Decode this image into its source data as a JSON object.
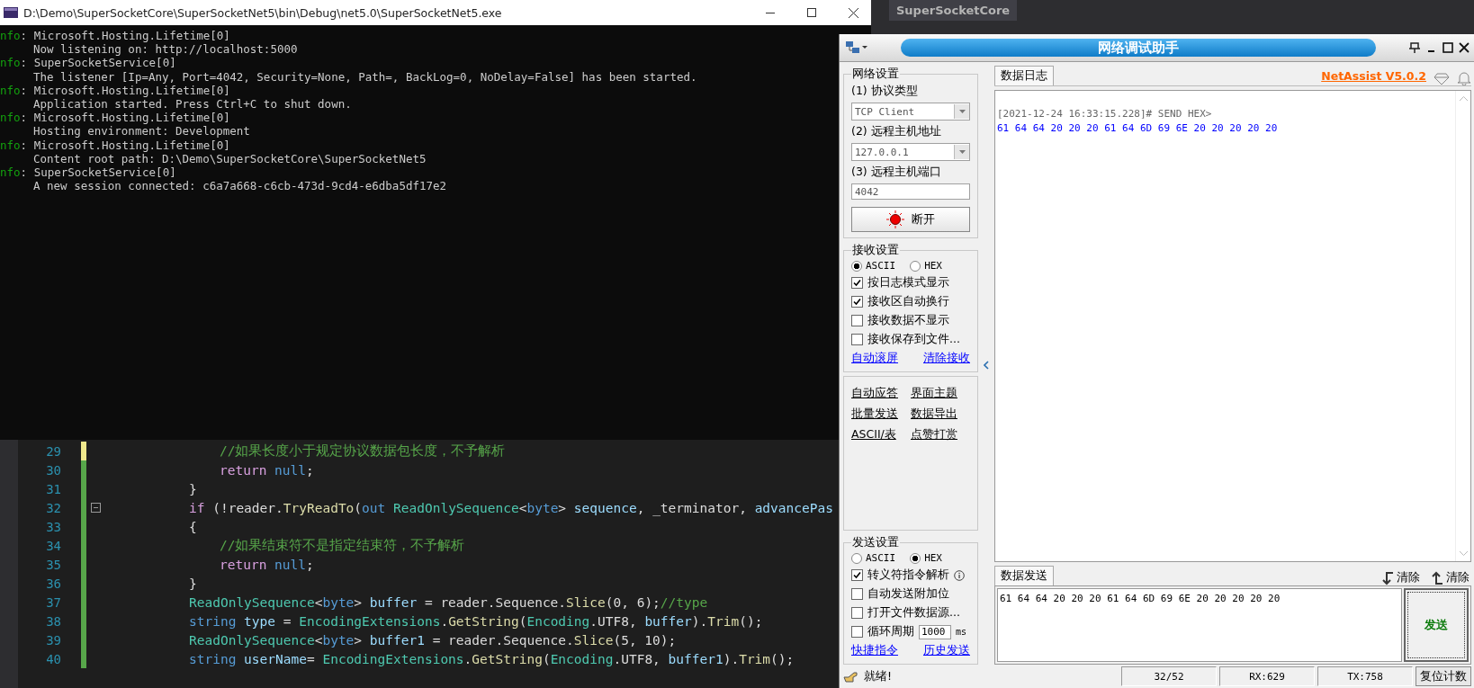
{
  "vs": {
    "tab": "SuperSocketCore"
  },
  "console": {
    "title": "D:\\Demo\\SuperSocketCore\\SuperSocketNet5\\bin\\Debug\\net5.0\\SuperSocketNet5.exe",
    "entries": [
      {
        "tag": "nfo",
        "separator": ":",
        "source": "Microsoft.Hosting.Lifetime[0]",
        "message": "Now listening on: http://localhost:5000"
      },
      {
        "tag": "nfo",
        "separator": ":",
        "source": "SuperSocketService[0]",
        "message": "The listener [Ip=Any, Port=4042, Security=None, Path=, BackLog=0, NoDelay=False] has been started."
      },
      {
        "tag": "nfo",
        "separator": ":",
        "source": "Microsoft.Hosting.Lifetime[0]",
        "message": "Application started. Press Ctrl+C to shut down."
      },
      {
        "tag": "nfo",
        "separator": ":",
        "source": "Microsoft.Hosting.Lifetime[0]",
        "message": "Hosting environment: Development"
      },
      {
        "tag": "nfo",
        "separator": ":",
        "source": "Microsoft.Hosting.Lifetime[0]",
        "message": "Content root path: D:\\Demo\\SuperSocketCore\\SuperSocketNet5"
      },
      {
        "tag": "nfo",
        "separator": ":",
        "source": "SuperSocketService[0]",
        "message": "A new session connected: c6a7a668-c6cb-473d-9cd4-e6dba5df17e2"
      }
    ]
  },
  "editor": {
    "lines": [
      {
        "number": "29",
        "kind": "inner",
        "unsaved": true,
        "fold_marker": false,
        "tokens": [
          {
            "kind": "comment",
            "text": "//如果长度小于规定协议数据包长度，不予解析"
          }
        ]
      },
      {
        "number": "30",
        "kind": "inner",
        "unsaved": false,
        "fold_marker": false,
        "tokens": [
          {
            "kind": "control",
            "text": "return"
          },
          {
            "kind": "keyword",
            "text": " null"
          },
          {
            "kind": "plain",
            "text": ";"
          }
        ]
      },
      {
        "number": "31",
        "kind": "outer",
        "unsaved": false,
        "fold_marker": false,
        "tokens": [
          {
            "kind": "plain",
            "text": "}"
          }
        ]
      },
      {
        "number": "32",
        "kind": "outer",
        "unsaved": false,
        "fold_marker": true,
        "tokens": [
          {
            "kind": "control",
            "text": "if"
          },
          {
            "kind": "plain",
            "text": " (!reader."
          },
          {
            "kind": "method",
            "text": "TryReadTo"
          },
          {
            "kind": "plain",
            "text": "("
          },
          {
            "kind": "keyword",
            "text": "out"
          },
          {
            "kind": "type",
            "text": " ReadOnlySequence"
          },
          {
            "kind": "plain",
            "text": "<"
          },
          {
            "kind": "keyword",
            "text": "byte"
          },
          {
            "kind": "plain",
            "text": "> "
          },
          {
            "kind": "variable",
            "text": "sequence"
          },
          {
            "kind": "plain",
            "text": ", _terminator, "
          },
          {
            "kind": "variable",
            "text": "advancePas"
          }
        ]
      },
      {
        "number": "33",
        "kind": "outer",
        "unsaved": false,
        "fold_marker": false,
        "tokens": [
          {
            "kind": "plain",
            "text": "{"
          }
        ]
      },
      {
        "number": "34",
        "kind": "inner",
        "unsaved": false,
        "fold_marker": false,
        "tokens": [
          {
            "kind": "comment",
            "text": "//如果结束符不是指定结束符，不予解析"
          }
        ]
      },
      {
        "number": "35",
        "kind": "inner",
        "unsaved": false,
        "fold_marker": false,
        "tokens": [
          {
            "kind": "control",
            "text": "return"
          },
          {
            "kind": "keyword",
            "text": " null"
          },
          {
            "kind": "plain",
            "text": ";"
          }
        ]
      },
      {
        "number": "36",
        "kind": "outer",
        "unsaved": false,
        "fold_marker": false,
        "tokens": [
          {
            "kind": "plain",
            "text": "}"
          }
        ]
      },
      {
        "number": "37",
        "kind": "outer",
        "unsaved": false,
        "fold_marker": false,
        "tokens": [
          {
            "kind": "type",
            "text": "ReadOnlySequence"
          },
          {
            "kind": "plain",
            "text": "<"
          },
          {
            "kind": "keyword",
            "text": "byte"
          },
          {
            "kind": "plain",
            "text": "> "
          },
          {
            "kind": "variable",
            "text": "buffer"
          },
          {
            "kind": "plain",
            "text": " = reader.Sequence."
          },
          {
            "kind": "method",
            "text": "Slice"
          },
          {
            "kind": "plain",
            "text": "(0, 6);"
          },
          {
            "kind": "comment",
            "text": "//type"
          }
        ]
      },
      {
        "number": "38",
        "kind": "outer",
        "unsaved": false,
        "fold_marker": false,
        "tokens": [
          {
            "kind": "keyword",
            "text": "string"
          },
          {
            "kind": "variable",
            "text": " type"
          },
          {
            "kind": "plain",
            "text": " = "
          },
          {
            "kind": "type",
            "text": "EncodingExtensions"
          },
          {
            "kind": "plain",
            "text": "."
          },
          {
            "kind": "method",
            "text": "GetString"
          },
          {
            "kind": "plain",
            "text": "("
          },
          {
            "kind": "type",
            "text": "Encoding"
          },
          {
            "kind": "plain",
            "text": ".UTF8, "
          },
          {
            "kind": "variable",
            "text": "buffer"
          },
          {
            "kind": "plain",
            "text": ")."
          },
          {
            "kind": "method",
            "text": "Trim"
          },
          {
            "kind": "plain",
            "text": "();"
          }
        ]
      },
      {
        "number": "39",
        "kind": "outer",
        "unsaved": false,
        "fold_marker": false,
        "tokens": [
          {
            "kind": "type",
            "text": "ReadOnlySequence"
          },
          {
            "kind": "plain",
            "text": "<"
          },
          {
            "kind": "keyword",
            "text": "byte"
          },
          {
            "kind": "plain",
            "text": "> "
          },
          {
            "kind": "variable",
            "text": "buffer1"
          },
          {
            "kind": "plain",
            "text": " = reader.Sequence."
          },
          {
            "kind": "method",
            "text": "Slice"
          },
          {
            "kind": "plain",
            "text": "(5, 10);"
          }
        ]
      },
      {
        "number": "40",
        "kind": "outer",
        "unsaved": false,
        "fold_marker": false,
        "tokens": [
          {
            "kind": "keyword",
            "text": "string"
          },
          {
            "kind": "variable",
            "text": " userName"
          },
          {
            "kind": "plain",
            "text": "= "
          },
          {
            "kind": "type",
            "text": "EncodingExtensions"
          },
          {
            "kind": "plain",
            "text": "."
          },
          {
            "kind": "method",
            "text": "GetString"
          },
          {
            "kind": "plain",
            "text": "("
          },
          {
            "kind": "type",
            "text": "Encoding"
          },
          {
            "kind": "plain",
            "text": ".UTF8, "
          },
          {
            "kind": "variable",
            "text": "buffer1"
          },
          {
            "kind": "plain",
            "text": ")."
          },
          {
            "kind": "method",
            "text": "Trim"
          },
          {
            "kind": "plain",
            "text": "();"
          }
        ]
      }
    ]
  },
  "netassist": {
    "title": "网络调试助手",
    "net_settings": {
      "title": "网络设置",
      "protocol_label": "(1) 协议类型",
      "protocol": "TCP Client",
      "host_label": "(2) 远程主机地址",
      "host": "127.0.0.1",
      "port_label": "(3) 远程主机端口",
      "port": "4042",
      "connect_button": "断开",
      "connected": true
    },
    "receive_settings": {
      "title": "接收设置",
      "modes": [
        {
          "label": "ASCII",
          "selected": true
        },
        {
          "label": "HEX",
          "selected": false
        }
      ],
      "options": [
        {
          "label": "按日志模式显示",
          "checked": true
        },
        {
          "label": "接收区自动换行",
          "checked": true
        },
        {
          "label": "接收数据不显示",
          "checked": false
        },
        {
          "label": "接收保存到文件...",
          "checked": false
        }
      ],
      "links": [
        "自动滚屏",
        "清除接收"
      ]
    },
    "tools": [
      "自动应答",
      "界面主题",
      "批量发送",
      "数据导出",
      "ASCII/表",
      "点赞打赏"
    ],
    "send_settings": {
      "title": "发送设置",
      "modes": [
        {
          "label": "ASCII",
          "selected": false
        },
        {
          "label": "HEX",
          "selected": true
        }
      ],
      "options": [
        {
          "kind": "info",
          "label": "转义符指令解析",
          "checked": true
        },
        {
          "kind": "check",
          "label": "自动发送附加位",
          "checked": false
        },
        {
          "kind": "check",
          "label": "打开文件数据源...",
          "checked": false
        },
        {
          "kind": "period",
          "label": "循环周期",
          "checked": false,
          "value": "1000",
          "unit": "ms"
        }
      ],
      "links": [
        "快捷指令",
        "历史发送"
      ]
    },
    "log": {
      "tab": "数据日志",
      "version_link": "NetAssist V5.0.2",
      "entries": [
        {
          "header": "[2021-12-24 16:33:15.228]# SEND HEX>",
          "data": "61 64 64 20 20 20 61 64 6D 69 6E 20 20 20 20 20"
        }
      ]
    },
    "send": {
      "tab": "数据发送",
      "clear_buttons": [
        "清除",
        "清除"
      ],
      "value": "61 64 64 20 20 20 61 64 6D 69 6E 20 20 20 20 20",
      "button": "发送"
    },
    "status": {
      "text": "就绪!",
      "count": "32/52",
      "rx": "RX:629",
      "tx": "TX:758",
      "reset_button": "复位计数"
    }
  }
}
